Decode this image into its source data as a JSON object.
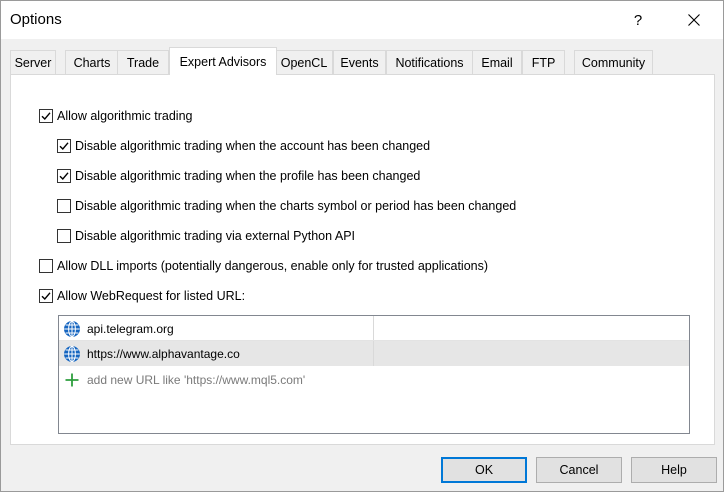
{
  "window": {
    "title": "Options",
    "help_glyph": "?",
    "close_icon": "close-icon"
  },
  "tabs": [
    {
      "label": "Server"
    },
    {
      "label": "Charts"
    },
    {
      "label": "Trade"
    },
    {
      "label": "Expert Advisors",
      "active": true
    },
    {
      "label": "OpenCL"
    },
    {
      "label": "Events"
    },
    {
      "label": "Notifications"
    },
    {
      "label": "Email"
    },
    {
      "label": "FTP"
    },
    {
      "label": "Community"
    }
  ],
  "options": {
    "allow_algo": {
      "label": "Allow algorithmic trading",
      "checked": true
    },
    "disable_account": {
      "label": "Disable algorithmic trading when the account has been changed",
      "checked": true
    },
    "disable_profile": {
      "label": "Disable algorithmic trading when the profile has been changed",
      "checked": true
    },
    "disable_symbol": {
      "label": "Disable algorithmic trading when the charts symbol or period has been changed",
      "checked": false
    },
    "disable_python": {
      "label": "Disable algorithmic trading via external Python API",
      "checked": false
    },
    "allow_dll": {
      "label": "Allow DLL imports (potentially dangerous, enable only for trusted applications)",
      "checked": false
    },
    "allow_webrequest": {
      "label": "Allow WebRequest for listed URL:",
      "checked": true
    }
  },
  "url_list": {
    "items": [
      {
        "url": "api.telegram.org",
        "icon": "globe-icon",
        "selected": false
      },
      {
        "url": "https://www.alphavantage.co",
        "icon": "globe-icon",
        "selected": true
      }
    ],
    "add_placeholder": "add new URL like 'https://www.mql5.com'",
    "add_icon": "plus-icon"
  },
  "buttons": {
    "ok": "OK",
    "cancel": "Cancel",
    "help": "Help"
  },
  "colors": {
    "accent": "#0078d7",
    "globe": "#1565c0",
    "plus": "#2e9e3e",
    "selected_row": "#e6e6e6"
  }
}
